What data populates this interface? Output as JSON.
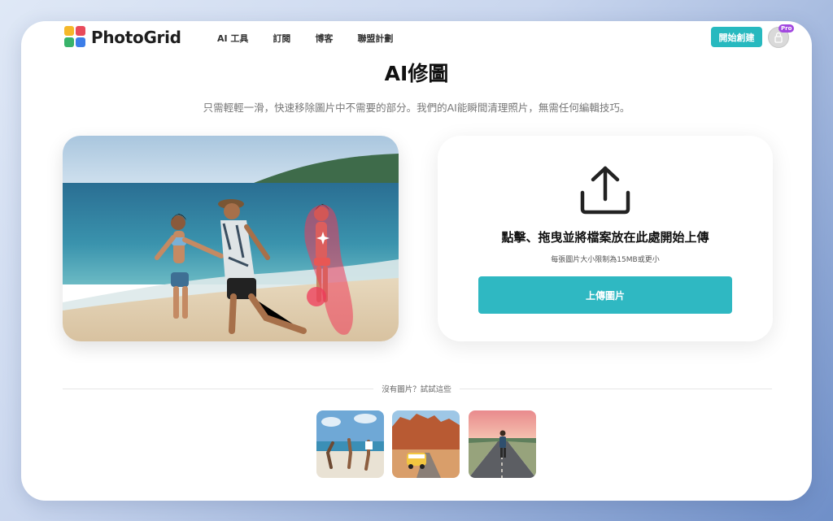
{
  "brand": {
    "name": "PhotoGrid"
  },
  "nav": {
    "items": [
      {
        "label": "AI 工具"
      },
      {
        "label": "訂閱"
      },
      {
        "label": "博客"
      },
      {
        "label": "聯盟計劃"
      }
    ]
  },
  "header": {
    "cta_label": "開始創建",
    "badge": "Pro"
  },
  "hero": {
    "title": "AI修圖",
    "subtitle": "只需輕輕一滑，快速移除圖片中不需要的部分。我們的AI能瞬間清理照片，無需任何編輯技巧。"
  },
  "upload": {
    "title": "點擊、拖曳並將檔案放在此處開始上傳",
    "limit": "每張圖片大小限制為15MB或更小",
    "button_label": "上傳圖片"
  },
  "samples": {
    "heading": "沒有圖片？試試這些"
  },
  "colors": {
    "accent": "#27b9bf",
    "badge": "#a248e0"
  }
}
